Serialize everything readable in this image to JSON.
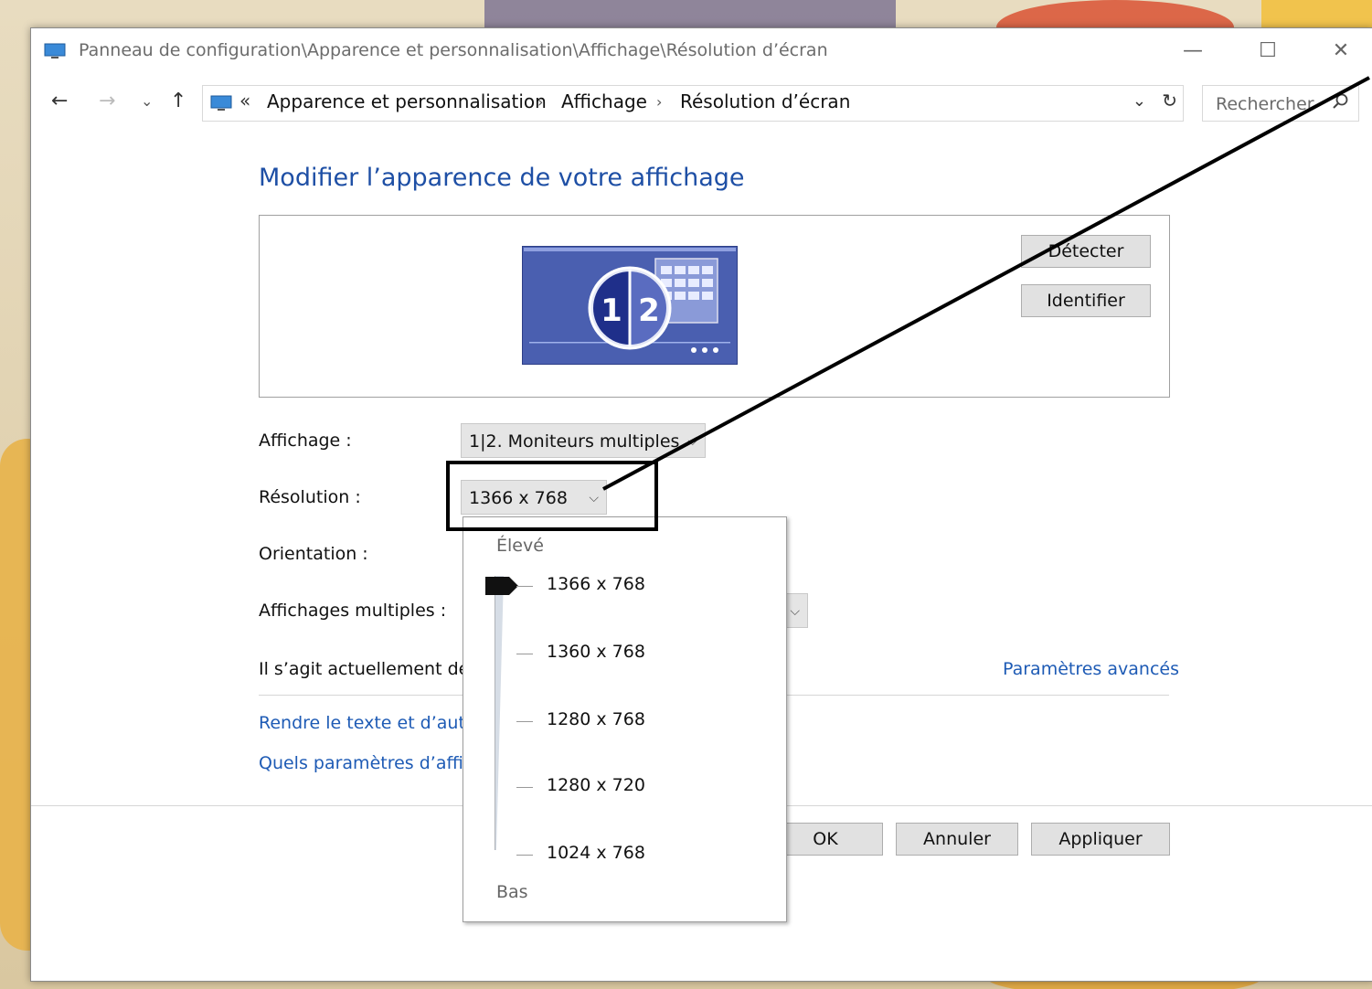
{
  "window": {
    "title": "Panneau de configuration\\Apparence et personnalisation\\Affichage\\Résolution d’écran",
    "minimize": "—",
    "maximize": "☐",
    "close": "✕"
  },
  "address": {
    "back": "←",
    "forward": "→",
    "recent": "⌄",
    "up": "↑",
    "chevrons": "«",
    "breadcrumbs": [
      "Apparence et personnalisation",
      "Affichage",
      "Résolution d’écran"
    ],
    "separator": "›",
    "dropdown": "⌄",
    "refresh": "↻",
    "search_placeholder": "Rechercher"
  },
  "page_title": "Modifier l’apparence de votre affichage",
  "preview": {
    "monitor_labels": [
      "1",
      "2"
    ],
    "detect_button": "Détecter",
    "identify_button": "Identifier"
  },
  "fields": {
    "display_label": "Affichage :",
    "display_value": "1|2. Moniteurs multiples",
    "resolution_label": "Résolution :",
    "resolution_value": "1366 x 768",
    "orientation_label": "Orientation :",
    "multi_label": "Affichages multiples :"
  },
  "status_text": "Il s’agit actuellement de",
  "advanced_link": "Paramètres avancés",
  "links": [
    "Rendre le texte et d’autr",
    "Quels paramètres d’affic"
  ],
  "footer": {
    "ok": "OK",
    "cancel": "Annuler",
    "apply": "Appliquer"
  },
  "resolution_popup": {
    "high_label": "Élevé",
    "low_label": "Bas",
    "options": [
      "1366 x 768",
      "1360 x 768",
      "1280 x 768",
      "1280 x 720",
      "1024 x 768"
    ],
    "selected": "1366 x 768"
  },
  "colors": {
    "link": "#1e5bb5",
    "title": "#1e4fa5",
    "monitor": "#4a5fb0"
  }
}
